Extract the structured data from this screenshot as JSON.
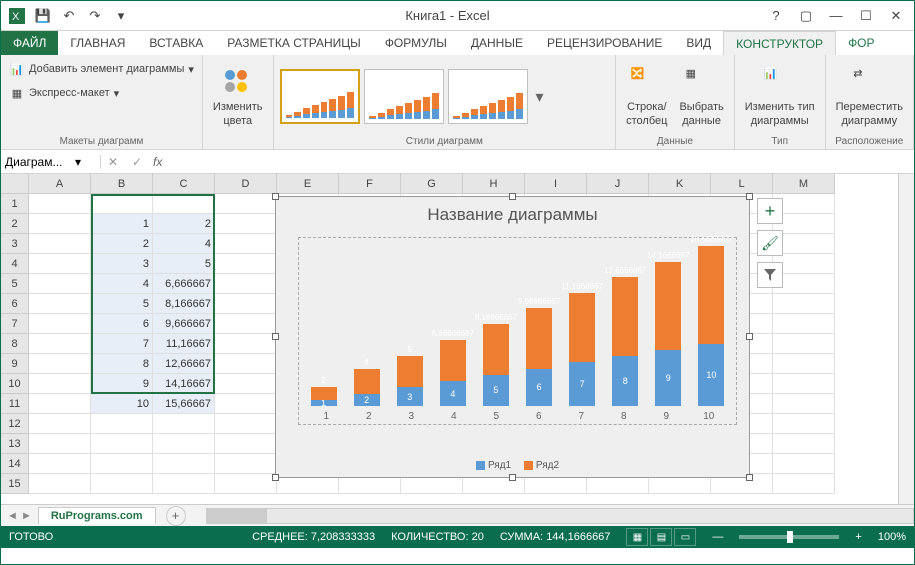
{
  "title": "Книга1 - Excel",
  "tabs": {
    "file": "ФАЙЛ",
    "items": [
      "ГЛАВНАЯ",
      "ВСТАВКА",
      "РАЗМЕТКА СТРАНИЦЫ",
      "ФОРМУЛЫ",
      "ДАННЫЕ",
      "РЕЦЕНЗИРОВАНИЕ",
      "ВИД",
      "КОНСТРУКТОР",
      "ФОР"
    ]
  },
  "ribbon": {
    "layouts": {
      "add_element": "Добавить элемент диаграммы",
      "express": "Экспресс-макет",
      "label": "Макеты диаграмм"
    },
    "colors": {
      "btn": "Изменить",
      "btn2": "цвета"
    },
    "styles": {
      "label": "Стили диаграмм"
    },
    "data": {
      "swap": "Строка/",
      "swap2": "столбец",
      "select": "Выбрать",
      "select2": "данные",
      "label": "Данные"
    },
    "type": {
      "btn": "Изменить тип",
      "btn2": "диаграммы",
      "label": "Тип"
    },
    "location": {
      "btn": "Переместить",
      "btn2": "диаграмму",
      "label": "Расположение"
    }
  },
  "namebox": "Диаграм...",
  "fx_label": "fx",
  "columns": [
    "A",
    "B",
    "C",
    "D",
    "E",
    "F",
    "G",
    "H",
    "I",
    "J",
    "K",
    "L",
    "M"
  ],
  "rows": [
    "1",
    "2",
    "3",
    "4",
    "5",
    "6",
    "7",
    "8",
    "9",
    "10",
    "11",
    "12",
    "13",
    "14",
    "15"
  ],
  "cells": {
    "B2": "1",
    "C2": "2",
    "B3": "2",
    "C3": "4",
    "B4": "3",
    "C4": "5",
    "B5": "4",
    "C5": "6,666667",
    "B6": "5",
    "C6": "8,166667",
    "B7": "6",
    "C7": "9,666667",
    "B8": "7",
    "C8": "11,16667",
    "B9": "8",
    "C9": "12,66667",
    "B10": "9",
    "C10": "14,16667",
    "B11": "10",
    "C11": "15,66667"
  },
  "chart_data": {
    "type": "bar",
    "title": "Название диаграммы",
    "categories": [
      "1",
      "2",
      "3",
      "4",
      "5",
      "6",
      "7",
      "8",
      "9",
      "10"
    ],
    "series": [
      {
        "name": "Ряд1",
        "values": [
          1,
          2,
          3,
          4,
          5,
          6,
          7,
          8,
          9,
          10
        ],
        "color": "#5b9bd5"
      },
      {
        "name": "Ряд2",
        "values": [
          2,
          4,
          5,
          6.666667,
          8.166667,
          9.666667,
          11.16667,
          12.66667,
          14.16667,
          15.66667
        ],
        "color": "#ed7d31"
      }
    ],
    "stacked": true,
    "xlabel": "",
    "ylabel": "",
    "data_labels_s1": [
      "1",
      "2",
      "3",
      "4",
      "5",
      "6",
      "7",
      "8",
      "9",
      "10"
    ],
    "data_labels_s2": [
      "2",
      "4",
      "5",
      "6,66666667",
      "8,16666667",
      "9,66666667",
      "11,1666667",
      "12,6666667",
      "14,1666667",
      "15,6666667"
    ],
    "legend": [
      "Ряд1",
      "Ряд2"
    ]
  },
  "sidebtns": {
    "plus": "+",
    "brush": "🖌",
    "filter": "▼"
  },
  "sheet": {
    "name": "RuPrograms.com"
  },
  "status": {
    "ready": "ГОТОВО",
    "avg_label": "СРЕДНЕЕ:",
    "avg": "7,208333333",
    "count_label": "КОЛИЧЕСТВО:",
    "count": "20",
    "sum_label": "СУММА:",
    "sum": "144,1666667",
    "zoom": "100%"
  }
}
